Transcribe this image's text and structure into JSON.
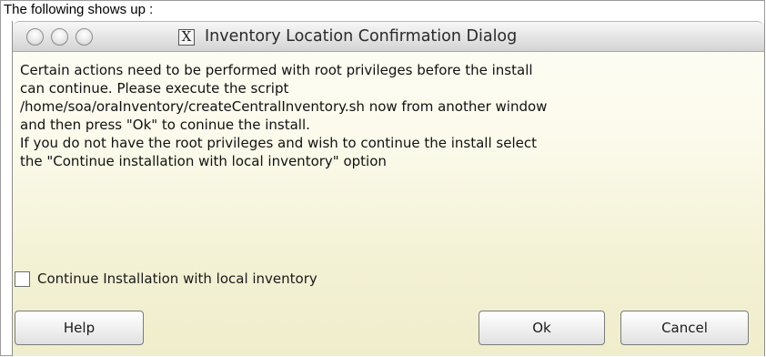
{
  "caption": "The following shows up :",
  "dialog": {
    "title": "Inventory Location Confirmation Dialog",
    "title_icon": "x11-icon",
    "window_buttons": [
      "close-circle-icon",
      "minimize-circle-icon",
      "maximize-circle-icon"
    ],
    "message_lines": [
      "Certain actions need to be performed with root privileges before the install",
      "can continue. Please execute the script",
      "/home/soa/oraInventory/createCentralInventory.sh now from another window",
      "and then press \"Ok\" to coninue the install.",
      "If you do not have the root privileges and wish to continue the install select",
      "the \"Continue installation with local inventory\" option"
    ],
    "checkbox_label": "Continue Installation with local inventory",
    "checkbox_checked": false,
    "buttons": {
      "help": "Help",
      "ok": "Ok",
      "cancel": "Cancel"
    }
  }
}
